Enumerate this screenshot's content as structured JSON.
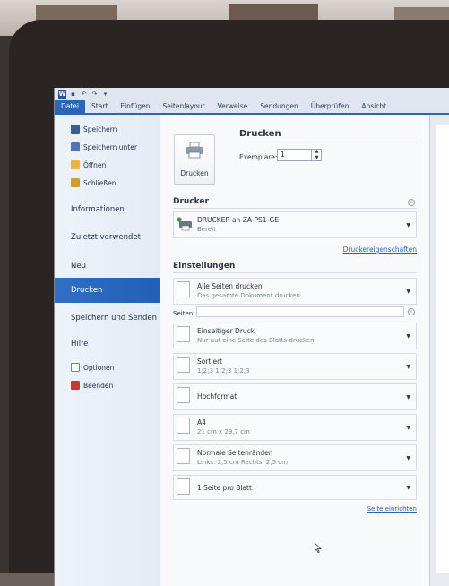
{
  "ribbon": {
    "tabs": [
      "Datei",
      "Start",
      "Einfügen",
      "Seitenlayout",
      "Verweise",
      "Sendungen",
      "Überprüfen",
      "Ansicht"
    ]
  },
  "nav": {
    "commands_top": [
      {
        "label": "Speichern",
        "icon": "save-icon"
      },
      {
        "label": "Speichern unter",
        "icon": "save-as-icon"
      },
      {
        "label": "Öffnen",
        "icon": "open-folder-icon"
      },
      {
        "label": "Schließen",
        "icon": "close-folder-icon"
      }
    ],
    "tabs": [
      "Informationen",
      "Zuletzt verwendet",
      "Neu",
      "Drucken",
      "Speichern und Senden",
      "Hilfe"
    ],
    "commands_bottom": [
      {
        "label": "Optionen",
        "icon": "options-icon"
      },
      {
        "label": "Beenden",
        "icon": "exit-icon"
      }
    ]
  },
  "print": {
    "title": "Drucken",
    "button_label": "Drucken",
    "copies_label": "Exemplare:",
    "copies_value": "1",
    "printer_section": "Drucker",
    "printer_name": "DRUCKER an ZA-PS1-GE",
    "printer_status": "Bereit",
    "printer_properties": "Druckereigenschaften",
    "settings_section": "Einstellungen",
    "pages_label": "Seiten:",
    "settings": [
      {
        "l1": "Alle Seiten drucken",
        "l2": "Das gesamte Dokument drucken"
      },
      {
        "l1": "Einseitiger Druck",
        "l2": "Nur auf eine Seite des Blatts drucken"
      },
      {
        "l1": "Sortiert",
        "l2": "1;2;3   1;2;3   1;2;3"
      },
      {
        "l1": "Hochformat",
        "l2": ""
      },
      {
        "l1": "A4",
        "l2": "21 cm x 29,7 cm"
      },
      {
        "l1": "Normale Seitenränder",
        "l2": "Links: 2,5 cm   Rechts: 2,5 cm"
      },
      {
        "l1": "1 Seite pro Blatt",
        "l2": ""
      }
    ],
    "page_setup": "Seite einrichten"
  },
  "colors": {
    "accent": "#2b65b8",
    "active_nav": "#2f6fc4"
  }
}
